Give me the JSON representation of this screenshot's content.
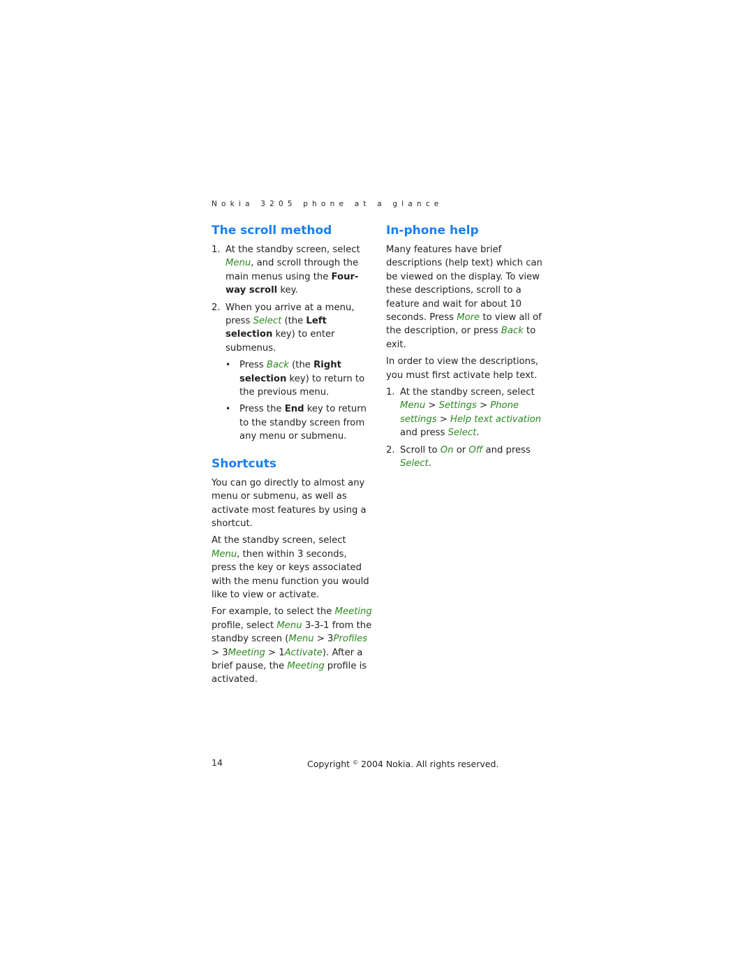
{
  "running_head": "Nokia 3205 phone at a glance",
  "colors": {
    "heading": "#1a7ff0",
    "ui_term": "#2a8a1e",
    "text": "#231f20"
  },
  "scroll_method": {
    "title": "The scroll method",
    "steps": [
      {
        "num": "1.",
        "parts": [
          "At the standby screen, select ",
          "Menu",
          ", and scroll through the main menus using the ",
          "Four-way scroll",
          " key."
        ]
      },
      {
        "num": "2.",
        "parts": [
          "When you arrive at a menu, press ",
          "Select",
          " (the ",
          "Left selection",
          " key) to enter submenus."
        ],
        "bullets": [
          {
            "symbol": "•",
            "parts": [
              "Press ",
              "Back",
              " (the ",
              "Right selection",
              " key) to return to the previous menu."
            ]
          },
          {
            "symbol": "•",
            "parts": [
              "Press the ",
              "End",
              " key to return to the standby screen from any menu or submenu."
            ]
          }
        ]
      }
    ]
  },
  "shortcuts": {
    "title": "Shortcuts",
    "p1": "You can go directly to almost any menu or submenu, as well as activate most features by using a shortcut.",
    "p2": [
      "At the standby screen, select ",
      "Menu",
      ", then within 3 seconds, press the key or keys associated with the menu function you would like to view or activate."
    ],
    "p3": [
      "For example, to select the ",
      "Meeting",
      " profile, select ",
      "Menu",
      " 3-3-1 from the standby screen (",
      "Menu",
      " > 3",
      "Profiles",
      " > 3",
      "Meeting",
      " > 1",
      "Activate",
      "). After a brief pause, the ",
      "Meeting",
      " profile is activated."
    ]
  },
  "inphone_help": {
    "title": "In-phone help",
    "p1": [
      "Many features have brief descriptions (help text) which can be viewed on the display. To view these descriptions, scroll to a feature and wait for about 10 seconds. Press ",
      "More",
      " to view all of the description, or press ",
      "Back",
      " to exit."
    ],
    "p2": "In order to view the descriptions, you must first activate help text.",
    "steps": [
      {
        "num": "1.",
        "parts": [
          "At the standby screen, select ",
          "Menu",
          " > ",
          "Settings",
          " > ",
          "Phone settings",
          " > ",
          "Help text activation",
          " and press ",
          "Select",
          "."
        ]
      },
      {
        "num": "2.",
        "parts": [
          "Scroll to ",
          "On",
          " or ",
          "Off",
          " and press ",
          "Select",
          "."
        ]
      }
    ]
  },
  "footer": {
    "page_number": "14",
    "copyright_prefix": "Copyright ",
    "copyright_symbol": "©",
    "copyright_suffix": " 2004 Nokia. All rights reserved."
  }
}
